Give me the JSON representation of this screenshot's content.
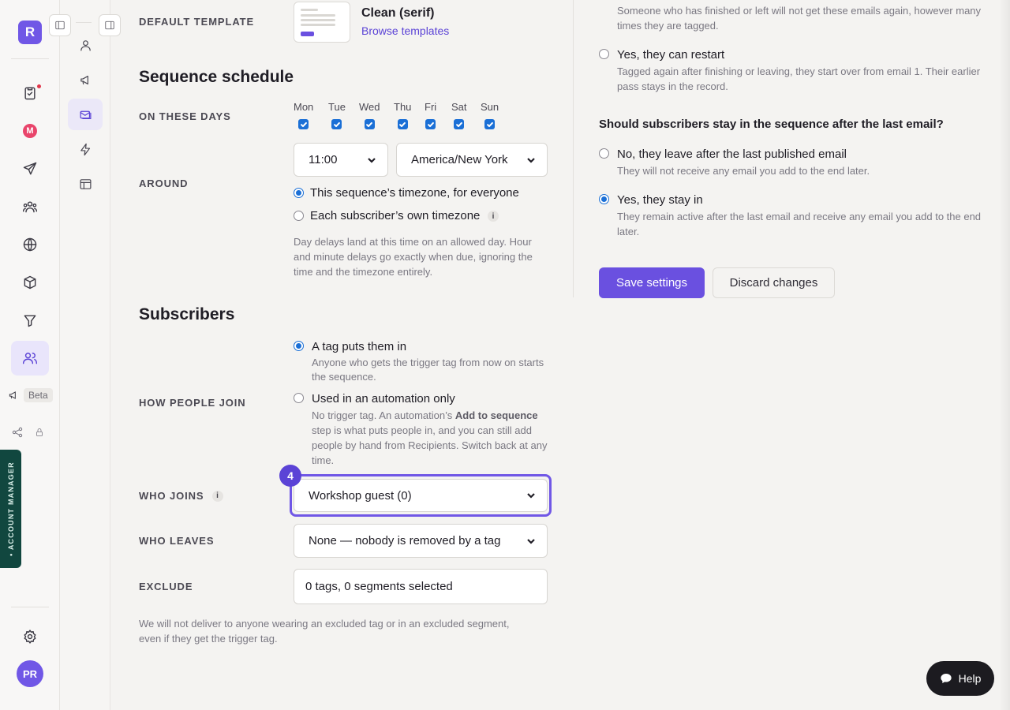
{
  "app": {
    "logo_letter": "R",
    "avatar_initials": "PR",
    "account_manager_label": "• ACCOUNT MANAGER",
    "beta_label": "Beta",
    "m_badge_letter": "M"
  },
  "nav_icons": [
    "clipboard-icon",
    "m-badge-icon",
    "send-icon",
    "audience-icon",
    "globe-icon",
    "cube-icon",
    "funnel-icon",
    "users-icon",
    "megaphone-icon",
    "share-icon",
    "lock-icon",
    "settings-icon"
  ],
  "sub_icons": [
    "user-icon",
    "megaphone-icon",
    "sequence-icon",
    "bolt-icon",
    "layout-icon"
  ],
  "template": {
    "label": "Default template",
    "name": "Clean (serif)",
    "browse_link": "Browse templates"
  },
  "schedule": {
    "title": "Sequence schedule",
    "days_label": "On these days",
    "days": [
      {
        "name": "Mon",
        "checked": true
      },
      {
        "name": "Tue",
        "checked": true
      },
      {
        "name": "Wed",
        "checked": true
      },
      {
        "name": "Thu",
        "checked": true
      },
      {
        "name": "Fri",
        "checked": true
      },
      {
        "name": "Sat",
        "checked": true
      },
      {
        "name": "Sun",
        "checked": true
      }
    ],
    "around_label": "Around",
    "time_value": "11:00",
    "timezone_value": "America/New York",
    "tz_option_sequence": "This sequence’s timezone, for everyone",
    "tz_option_subscriber": "Each subscriber’s own timezone",
    "note": "Day delays land at this time on an allowed day. Hour and minute delays go exactly when due, ignoring the time and the timezone entirely."
  },
  "subscribers": {
    "title": "Subscribers",
    "join_label": "How people join",
    "join_tag_title": "A tag puts them in",
    "join_tag_desc": "Anyone who gets the trigger tag from now on starts the sequence.",
    "join_auto_title": "Used in an automation only",
    "join_auto_desc_pre": "No trigger tag. An automation’s ",
    "join_auto_desc_bold": "Add to sequence",
    "join_auto_desc_post": " step is what puts people in, and you can still add people by hand from Recipients. Switch back at any time.",
    "who_joins_label": "Who joins",
    "who_joins_value": "Workshop guest (0)",
    "step_number": "4",
    "who_leaves_label": "Who leaves",
    "who_leaves_value": "None — nobody is removed by a tag",
    "exclude_label": "Exclude",
    "exclude_value": "0 tags, 0 segments selected",
    "exclude_note": "We will not deliver to anyone wearing an excluded tag or in an excluded segment, even if they get the trigger tag."
  },
  "restart": {
    "no_desc": "Someone who has finished or left will not get these emails again, however many times they are tagged.",
    "yes_title": "Yes, they can restart",
    "yes_desc": "Tagged again after finishing or leaving, they start over from email 1. Their earlier pass stays in the record."
  },
  "stay": {
    "question": "Should subscribers stay in the sequence after the last email?",
    "leave_title": "No, they leave after the last published email",
    "leave_desc": "They will not receive any email you add to the end later.",
    "stay_title": "Yes, they stay in",
    "stay_desc": "They remain active after the last email and receive any email you add to the end later."
  },
  "actions": {
    "save": "Save settings",
    "discard": "Discard changes"
  },
  "help_label": "Help",
  "colors": {
    "accent": "#6a50e0",
    "checkbox": "#1a6fd6",
    "account_tab": "#11473f"
  }
}
